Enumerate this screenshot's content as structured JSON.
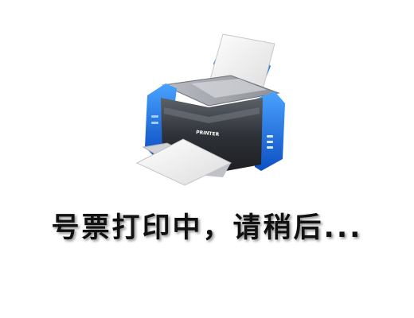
{
  "status": {
    "message": "号票打印中，请稍后..."
  },
  "printer": {
    "icon": "printer-icon",
    "label": "PRINTER"
  },
  "colors": {
    "accent": "#1f6fe0",
    "body": "#3a3d44",
    "paper": "#f4f4f4",
    "background": "#ffffff"
  }
}
